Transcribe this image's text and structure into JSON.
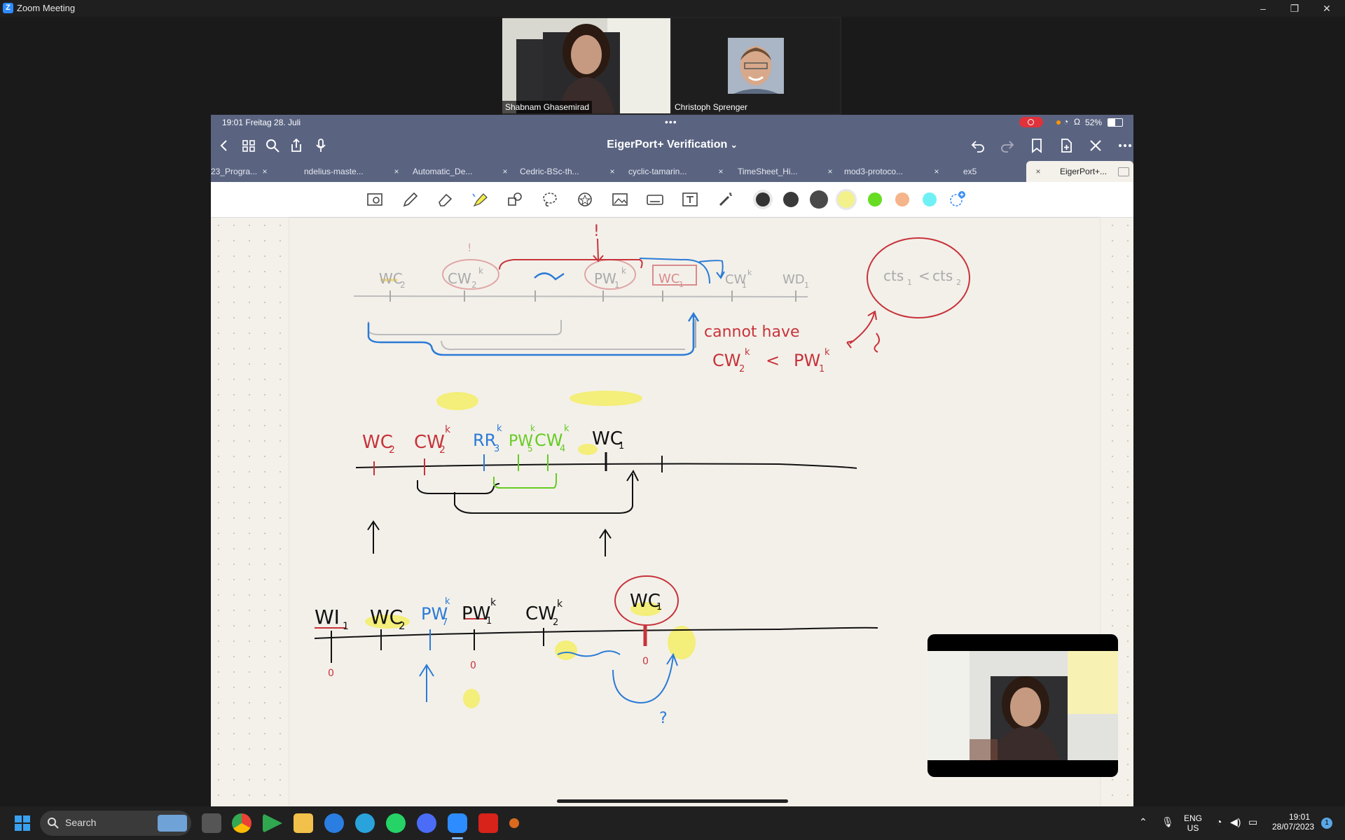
{
  "window": {
    "title": "Zoom Meeting",
    "app_logo": "Z",
    "minimize": "–",
    "restore": "❐",
    "close": "✕"
  },
  "participants": [
    {
      "name": "Shabnam Ghasemirad"
    },
    {
      "name": "Christoph Sprenger"
    }
  ],
  "ipad_status": {
    "time_date": "19:01  Freitag 28. Juli",
    "more": "•••",
    "battery": "52%"
  },
  "document": {
    "title": "EigerPort+ Verification",
    "chevron": "⌄"
  },
  "tabs": [
    {
      "label": "23_Progra..."
    },
    {
      "label": "ndelius-maste..."
    },
    {
      "label": "Automatic_De..."
    },
    {
      "label": "Cedric-BSc-th..."
    },
    {
      "label": "cyclic-tamarin..."
    },
    {
      "label": "TimeSheet_Hi..."
    },
    {
      "label": "mod3-protoco..."
    },
    {
      "label": "ex5"
    },
    {
      "label": "EigerPort+..."
    }
  ],
  "tab_close_glyph": "×",
  "colors": [
    "#333333",
    "#3a3a3a",
    "#4a4a4a",
    "#f3f18a",
    "#66dd22",
    "#f5b48a",
    "#6ff0f5"
  ],
  "handwriting": {
    "top": {
      "labels": [
        "WC",
        "CW",
        "PW",
        "WC",
        "CW",
        "WD"
      ],
      "subs": [
        "2",
        "2",
        "1",
        "1",
        "1",
        "1"
      ],
      "sups": [
        "k",
        "k",
        "k"
      ],
      "bang1": "!",
      "bang2": "!",
      "circle": "cts",
      "circle_sub1": "1",
      "circle_sub2": "2",
      "circle_lt": "<"
    },
    "note": {
      "line1": "cannot have",
      "cw": "CW",
      "lt": "<",
      "pw": "PW",
      "sub2": "2",
      "sub1": "1",
      "sup": "k"
    },
    "middle": {
      "labels": [
        "WC",
        "CW",
        "RR",
        "PW",
        "CW",
        "WC"
      ],
      "subs": [
        "2",
        "2",
        "3",
        "5",
        "4",
        "1"
      ],
      "sups": [
        "k",
        "k",
        "k",
        "k"
      ]
    },
    "bottom": {
      "labels": [
        "WI",
        "WC",
        "PW",
        "PW",
        "CW",
        "WC"
      ],
      "subs": [
        "1",
        "2",
        "7",
        "1",
        "2",
        "1"
      ],
      "sups": [
        "k",
        "k",
        "k"
      ],
      "zero": "0",
      "question": "?"
    }
  },
  "taskbar": {
    "search": "Search",
    "lang_1": "ENG",
    "lang_2": "US",
    "time": "19:01",
    "date": "28/07/2023",
    "notification_count": "1"
  }
}
